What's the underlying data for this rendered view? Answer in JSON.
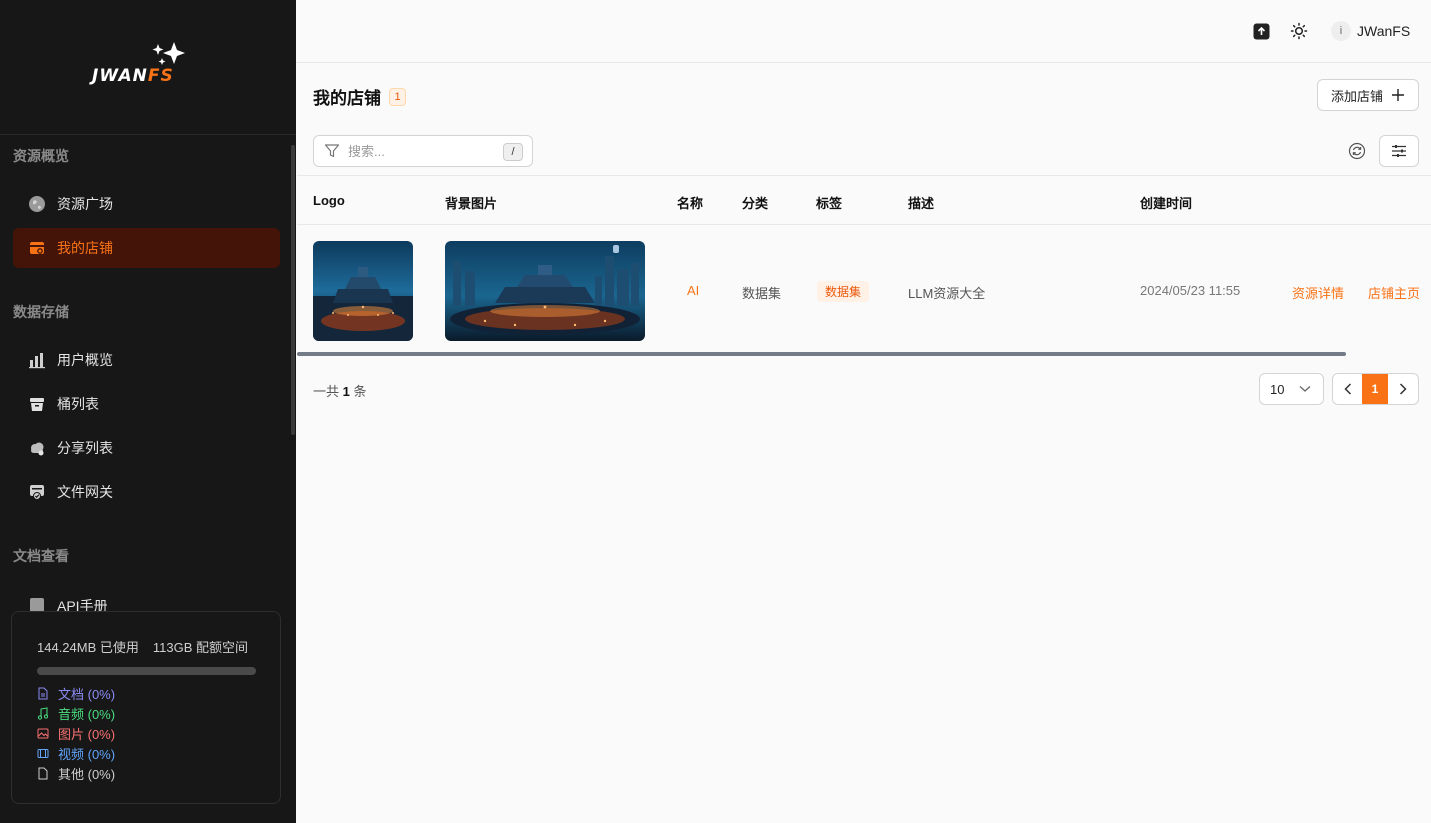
{
  "app": {
    "logo_main": "JWAN",
    "logo_accent": "FS"
  },
  "sidebar": {
    "groups": [
      {
        "title": "资源概览",
        "items": [
          {
            "label": "资源广场",
            "icon": "globe-icon"
          },
          {
            "label": "我的店铺",
            "icon": "store-icon",
            "active": true
          }
        ]
      },
      {
        "title": "数据存储",
        "items": [
          {
            "label": "用户概览",
            "icon": "bar-chart-icon"
          },
          {
            "label": "桶列表",
            "icon": "bucket-icon"
          },
          {
            "label": "分享列表",
            "icon": "cloud-share-icon"
          },
          {
            "label": "文件网关",
            "icon": "gateway-icon"
          }
        ]
      },
      {
        "title": "文档查看",
        "items": [
          {
            "label": "API手册",
            "icon": "api-book-icon"
          }
        ]
      }
    ],
    "storage": {
      "used": "144.24MB 已使用",
      "quota": "113GB 配额空间",
      "used_fraction": 0,
      "categories": [
        {
          "label": "文档 (0%)",
          "color": "#8b8bf5",
          "icon": "document-icon"
        },
        {
          "label": "音频 (0%)",
          "color": "#4ade80",
          "icon": "music-icon"
        },
        {
          "label": "图片 (0%)",
          "color": "#f87171",
          "icon": "image-icon"
        },
        {
          "label": "视频 (0%)",
          "color": "#60a5fa",
          "icon": "video-icon"
        },
        {
          "label": "其他 (0%)",
          "color": "#cfcfcf",
          "icon": "file-icon"
        }
      ]
    }
  },
  "header": {
    "avatar_initial": "i",
    "username": "JWanFS"
  },
  "main": {
    "title": "我的店铺",
    "count": "1",
    "add_button": "添加店铺",
    "search_placeholder": "搜索...",
    "search_shortcut": "/",
    "columns": [
      "Logo",
      "背景图片",
      "名称",
      "分类",
      "标签",
      "描述",
      "创建时间"
    ],
    "rows": [
      {
        "name": "AI",
        "category": "数据集",
        "tag": "数据集",
        "description": "LLM资源大全",
        "created": "2024/05/23 11:55",
        "action_detail": "资源详情",
        "action_home": "店铺主页"
      }
    ],
    "total_prefix": "一共",
    "total_count": "1",
    "total_suffix": "条",
    "page_size": "10",
    "current_page": "1"
  },
  "colors": {
    "accent": "#f97316",
    "sidebar_bg": "#171717",
    "active_bg": "#431407"
  }
}
